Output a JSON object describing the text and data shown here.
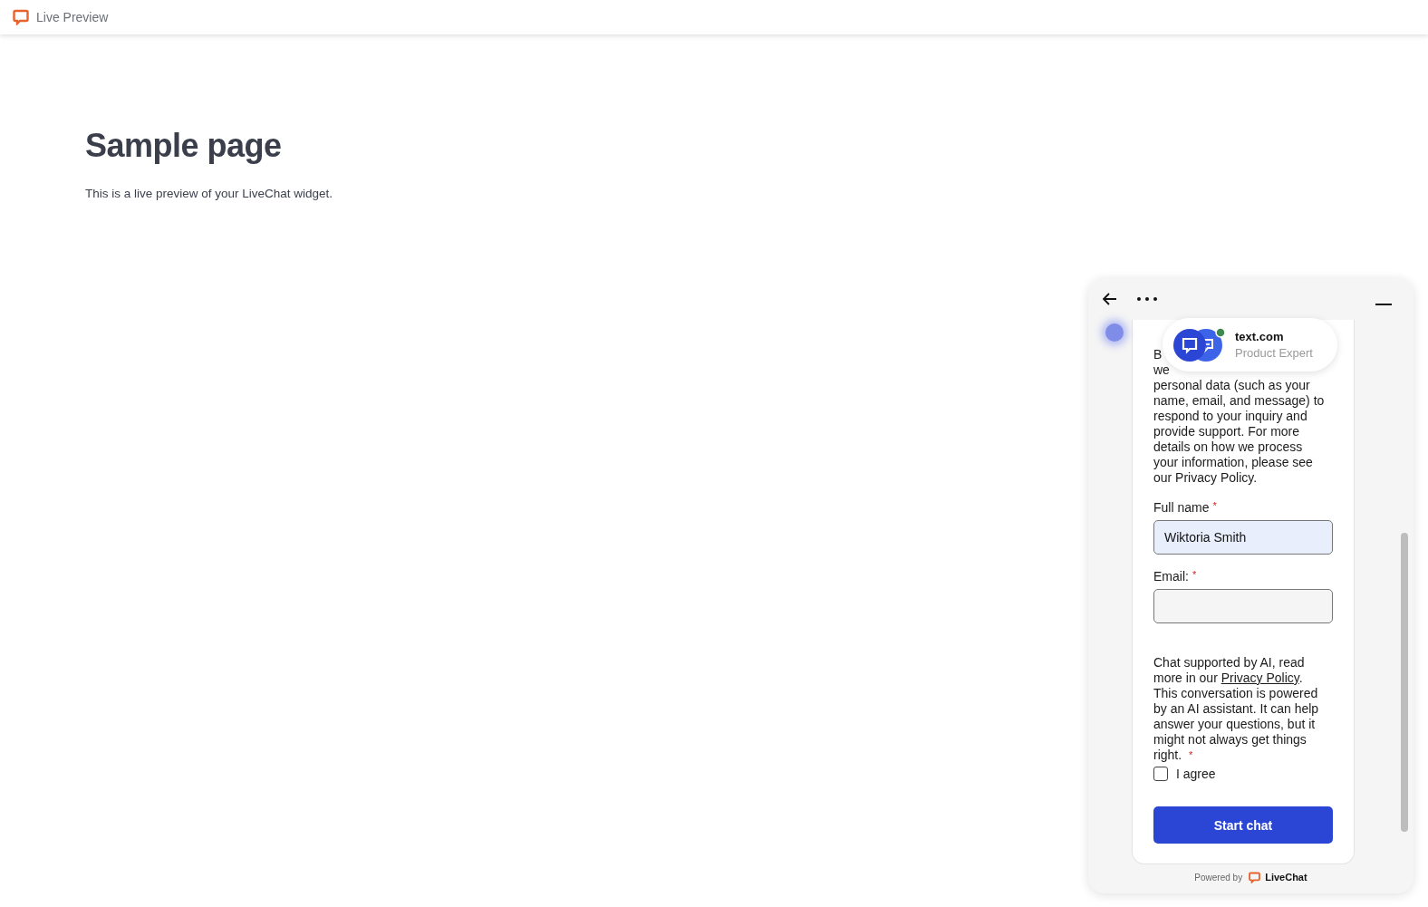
{
  "topbar": {
    "title": "Live Preview"
  },
  "page": {
    "heading": "Sample page",
    "text": "This is a live preview of your LiveChat widget."
  },
  "widget": {
    "agent": {
      "name": "text.com",
      "role": "Product Expert",
      "online": true
    },
    "consent_cut_lines": [
      "B",
      "we"
    ],
    "consent_text": "personal data (such as your name, email, and message) to respond to your inquiry and provide support. For more details on how we process your information, please see our Privacy Policy.",
    "fields": [
      {
        "label": "Full name",
        "required_mark": "*",
        "value": "Wiktoria Smith",
        "filled": true
      },
      {
        "label": "Email:",
        "required_mark": "*",
        "filled": false
      }
    ],
    "ai_notice": {
      "before": "Chat supported by AI, read more in our ",
      "link": "Privacy Policy",
      "after": ". This conversation is powered by an AI assistant. It can help answer your questions, but it might not always get things right.",
      "required_mark": "*"
    },
    "agree": {
      "label": "I agree",
      "checked": false
    },
    "submit": "Start chat",
    "footer": {
      "prefix": "Powered by",
      "brand": "LiveChat"
    }
  }
}
